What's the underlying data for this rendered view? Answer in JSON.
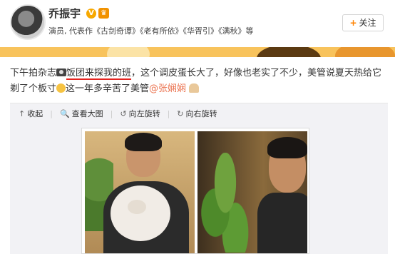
{
  "header": {
    "username": "乔振宇",
    "verified_badge": "V",
    "member_badge": "♛",
    "bio": "演员, 代表作《古剑奇谭》《老有所依》《华胥引》《满秋》等",
    "follow_plus": "+",
    "follow_label": "关注"
  },
  "post": {
    "text_1": "下午拍杂志",
    "text_link": "饭团来探我的班",
    "text_2": "，这个调皮蛋长大了，好像也老实了不少，美管说夏天热给它剃了个板寸",
    "text_3": "这一年多辛苦了美管",
    "mention": "@张娴娴",
    "media_tools": {
      "collapse": {
        "icon": "↑",
        "label": "收起"
      },
      "view_large": {
        "icon": "🔍",
        "label": "查看大图"
      },
      "rotate_left": {
        "icon": "↺",
        "label": "向左旋转"
      },
      "rotate_right": {
        "icon": "↻",
        "label": "向右旋转"
      }
    }
  },
  "colors": {
    "accent_orange": "#ff8200",
    "mention": "#eb7350",
    "underline": "#e4231f"
  }
}
